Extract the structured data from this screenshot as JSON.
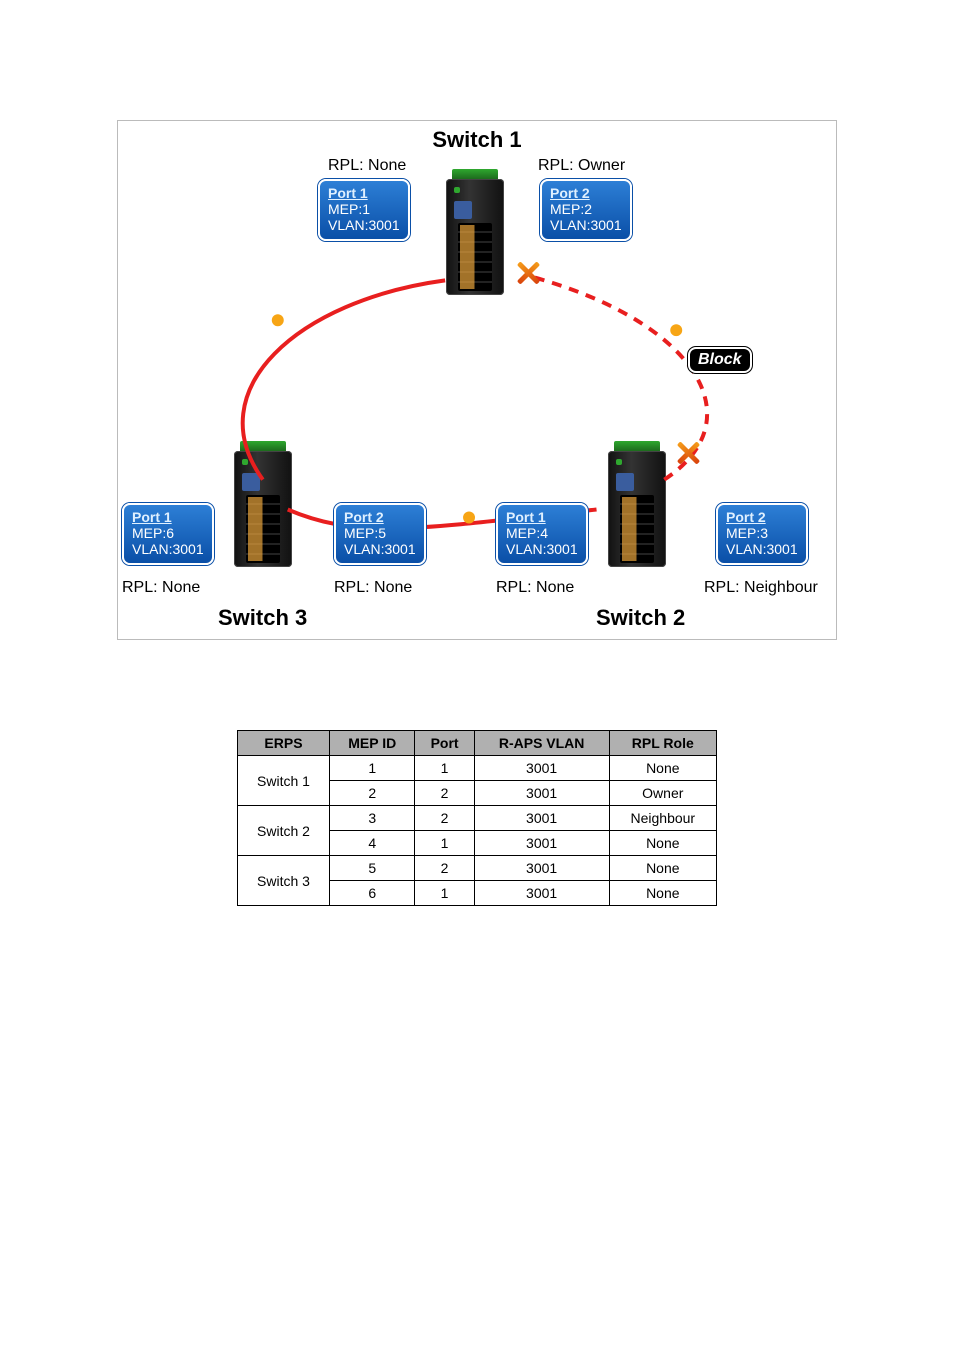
{
  "diagram": {
    "title_top": "Switch 1",
    "title_bl": "Switch 3",
    "title_br": "Switch 2",
    "block": "Block",
    "rpl": {
      "s1_left": "RPL: None",
      "s1_right": "RPL: Owner",
      "s3_left": "RPL: None",
      "s3_right": "RPL: None",
      "s2_left": "RPL: None",
      "s2_right": "RPL: Neighbour"
    },
    "boxes": {
      "s1p1": {
        "port": "Port 1",
        "mep": "MEP:1",
        "vlan": "VLAN:3001"
      },
      "s1p2": {
        "port": "Port 2",
        "mep": "MEP:2",
        "vlan": "VLAN:3001"
      },
      "s3p1": {
        "port": "Port 1",
        "mep": "MEP:6",
        "vlan": "VLAN:3001"
      },
      "s3p2": {
        "port": "Port 2",
        "mep": "MEP:5",
        "vlan": "VLAN:3001"
      },
      "s2p1": {
        "port": "Port 1",
        "mep": "MEP:4",
        "vlan": "VLAN:3001"
      },
      "s2p2": {
        "port": "Port 2",
        "mep": "MEP:3",
        "vlan": "VLAN:3001"
      }
    }
  },
  "table": {
    "headers": [
      "ERPS",
      "MEP ID",
      "Port",
      "R-APS VLAN",
      "RPL Role"
    ],
    "rows": [
      {
        "switch": "Switch 1",
        "a": {
          "mep": "1",
          "port": "1",
          "vlan": "3001",
          "role": "None"
        },
        "b": {
          "mep": "2",
          "port": "2",
          "vlan": "3001",
          "role": "Owner"
        }
      },
      {
        "switch": "Switch 2",
        "a": {
          "mep": "3",
          "port": "2",
          "vlan": "3001",
          "role": "Neighbour"
        },
        "b": {
          "mep": "4",
          "port": "1",
          "vlan": "3001",
          "role": "None"
        }
      },
      {
        "switch": "Switch 3",
        "a": {
          "mep": "5",
          "port": "2",
          "vlan": "3001",
          "role": "None"
        },
        "b": {
          "mep": "6",
          "port": "1",
          "vlan": "3001",
          "role": "None"
        }
      }
    ]
  }
}
